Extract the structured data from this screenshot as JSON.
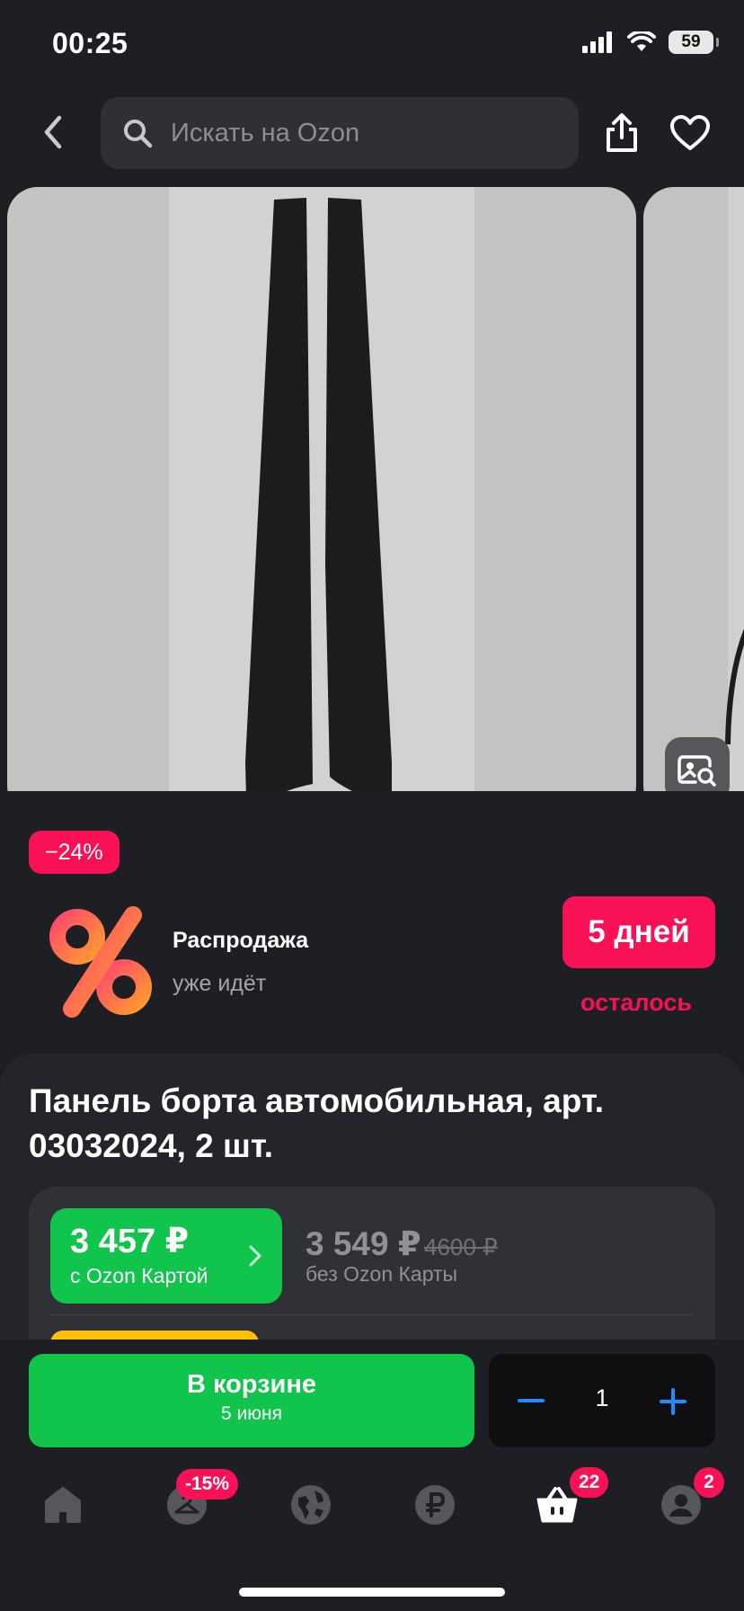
{
  "status_bar": {
    "time": "00:25",
    "battery": "59"
  },
  "search": {
    "placeholder": "Искать на Ozon"
  },
  "discount": "−24%",
  "promo": {
    "title": "Распродажа",
    "subtitle": "уже идёт",
    "timer": "5 дней",
    "timer_suffix": "осталось"
  },
  "product": {
    "title": "Панель борта автомобильная, арт. 03032024, 2 шт."
  },
  "price": {
    "ozon_card_price": "3 457 ₽",
    "ozon_card_label": "с Ozon Картой",
    "regular_price": "3 549 ₽",
    "old_price": "4600 ₽",
    "regular_label": "без Ozon Карты"
  },
  "cart": {
    "label": "В корзине",
    "delivery_date": "5 июня",
    "quantity": "1"
  },
  "tabs": [
    {
      "name": "home",
      "icon": "home-icon"
    },
    {
      "name": "fresh",
      "icon": "hanger-icon",
      "badge": "-15%"
    },
    {
      "name": "travel",
      "icon": "globe-icon"
    },
    {
      "name": "finance",
      "icon": "ruble-icon"
    },
    {
      "name": "cart",
      "icon": "basket-icon",
      "badge": "22"
    },
    {
      "name": "profile",
      "icon": "profile-icon",
      "badge": "2"
    }
  ],
  "colors": {
    "accent_green": "#10c44c",
    "accent_pink": "#f91155",
    "accent_blue": "#1f8cff",
    "background": "#1d1f24"
  }
}
